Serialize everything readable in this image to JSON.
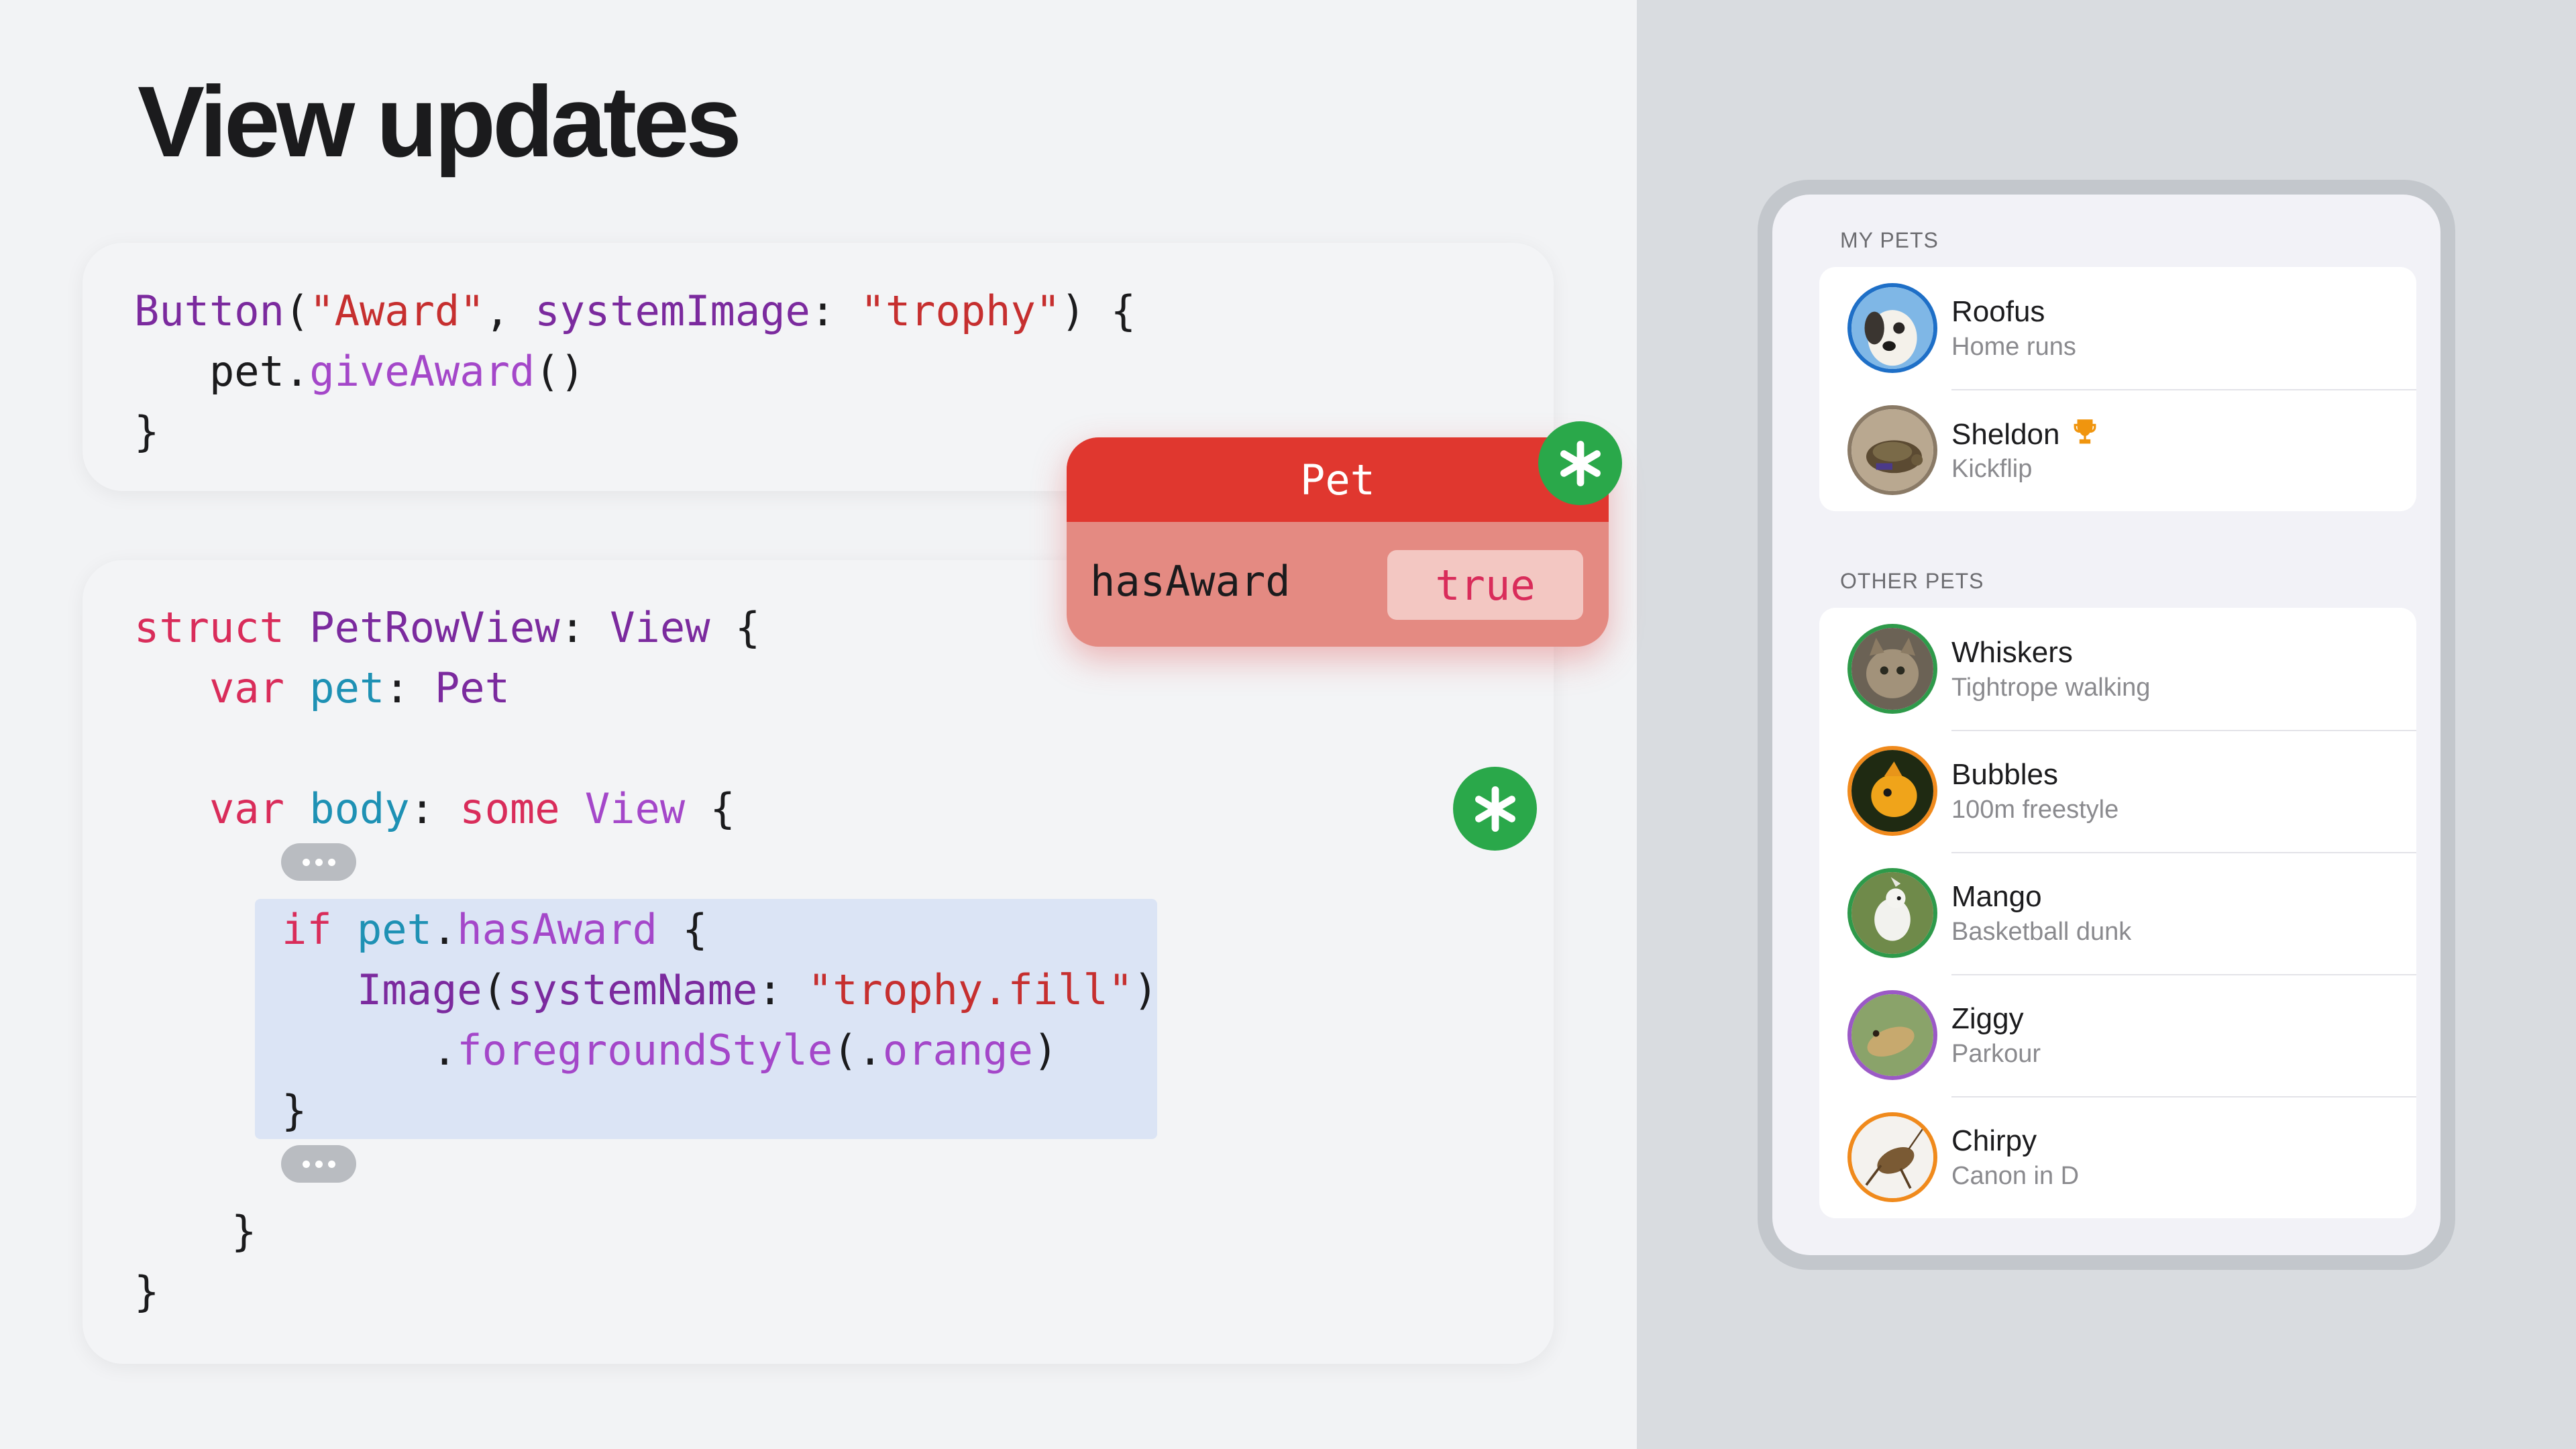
{
  "slide": {
    "title": "View updates"
  },
  "code_top": {
    "line1": {
      "fn": "Button",
      "p1": "(",
      "s1": "\"Award\"",
      "p2": ", ",
      "lbl": "systemImage",
      "p3": ": ",
      "s2": "\"trophy\"",
      "p4": ") {"
    },
    "line2": {
      "obj": "pet",
      "dot": ".",
      "fn": "giveAward",
      "p": "()"
    },
    "line3": "}"
  },
  "code_main": {
    "l1": {
      "kw": "struct",
      "name": "PetRowView",
      "colon": ": ",
      "ty": "View",
      "brace": " {"
    },
    "l2": {
      "kw": "var",
      "name": "pet",
      "colon": ": ",
      "ty": "Pet"
    },
    "l3": {
      "kw": "var",
      "name": "body",
      "colon": ": ",
      "kw2": "some",
      "ty": "View",
      "brace": " {"
    },
    "l4": {
      "kw": "if",
      "obj": "pet",
      "dot": ".",
      "prop": "hasAward",
      "brace": " {"
    },
    "l5": {
      "ty": "Image",
      "p1": "(",
      "lbl": "systemName",
      "p2": ": ",
      "st": "\"trophy.fill\"",
      "p3": ")"
    },
    "l6": {
      "dot": ".",
      "fn": "foregroundStyle",
      "p1": "(.",
      "arg": "orange",
      "p2": ")"
    },
    "l7": "}",
    "l8": "}",
    "l9": "}"
  },
  "pet_card": {
    "title": "Pet",
    "property": "hasAward",
    "value": "true"
  },
  "badges": {
    "icon": "asterisk-icon",
    "color": "#2aa84a"
  },
  "pets_app": {
    "sections": [
      {
        "header": "MY PETS",
        "pets": [
          {
            "name": "Roofus",
            "trick": "Home runs",
            "ring": "#1e6fc7",
            "award": false
          },
          {
            "name": "Sheldon",
            "trick": "Kickflip",
            "ring": "#8a7a66",
            "award": true
          }
        ]
      },
      {
        "header": "OTHER PETS",
        "pets": [
          {
            "name": "Whiskers",
            "trick": "Tightrope walking",
            "ring": "#2e9a4a",
            "award": false
          },
          {
            "name": "Bubbles",
            "trick": "100m freestyle",
            "ring": "#f08a1c",
            "award": false
          },
          {
            "name": "Mango",
            "trick": "Basketball dunk",
            "ring": "#2e9a4a",
            "award": false
          },
          {
            "name": "Ziggy",
            "trick": "Parkour",
            "ring": "#9b59c6",
            "award": false
          },
          {
            "name": "Chirpy",
            "trick": "Canon in D",
            "ring": "#f08a1c",
            "award": false
          }
        ]
      }
    ],
    "award_icon": "trophy-icon",
    "award_color": "#f0950e"
  }
}
